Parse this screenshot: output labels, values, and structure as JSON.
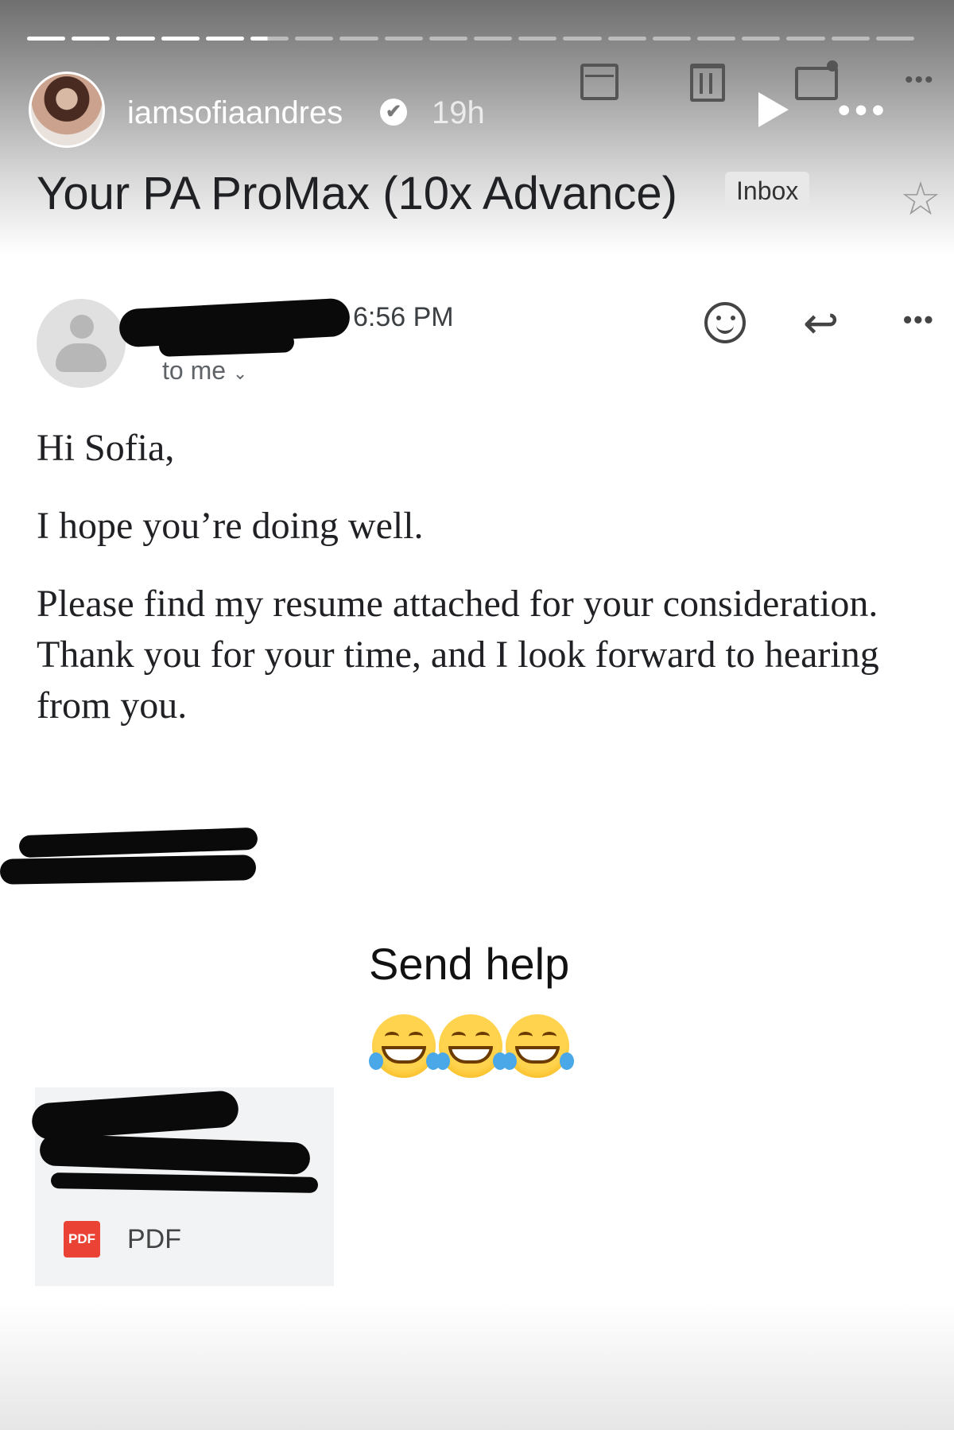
{
  "story": {
    "username": "iamsofiaandres",
    "time_ago": "19h",
    "verified_mark": "✔",
    "segments_total": 20,
    "segments_completed": 5,
    "current_segment_progress": 0.45
  },
  "email": {
    "subject": "Your PA ProMax (10x Advance)",
    "label": "Inbox",
    "time": "6:56 PM",
    "recipient": "to me",
    "greeting": "Hi Sofia,",
    "line1": "I hope you’re doing well.",
    "paragraph": "Please find my resume attached for your consideration. Thank you for your time, and I look forward to hearing from you.",
    "attachment": {
      "badge": "PDF",
      "type_label": "PDF"
    }
  },
  "caption": {
    "text": "Send help",
    "emojis": [
      "face-with-tears-of-joy",
      "face-with-tears-of-joy",
      "face-with-tears-of-joy"
    ]
  },
  "icons": {
    "archive": "archive-icon",
    "trash": "trash-icon",
    "mail": "mark-unread-icon",
    "star": "star-icon",
    "reply": "reply-icon",
    "react": "emoji-react-icon",
    "play": "play-icon"
  },
  "colors": {
    "pdf_red": "#ea4335",
    "text_dark": "#202124",
    "muted": "#5f6368"
  }
}
